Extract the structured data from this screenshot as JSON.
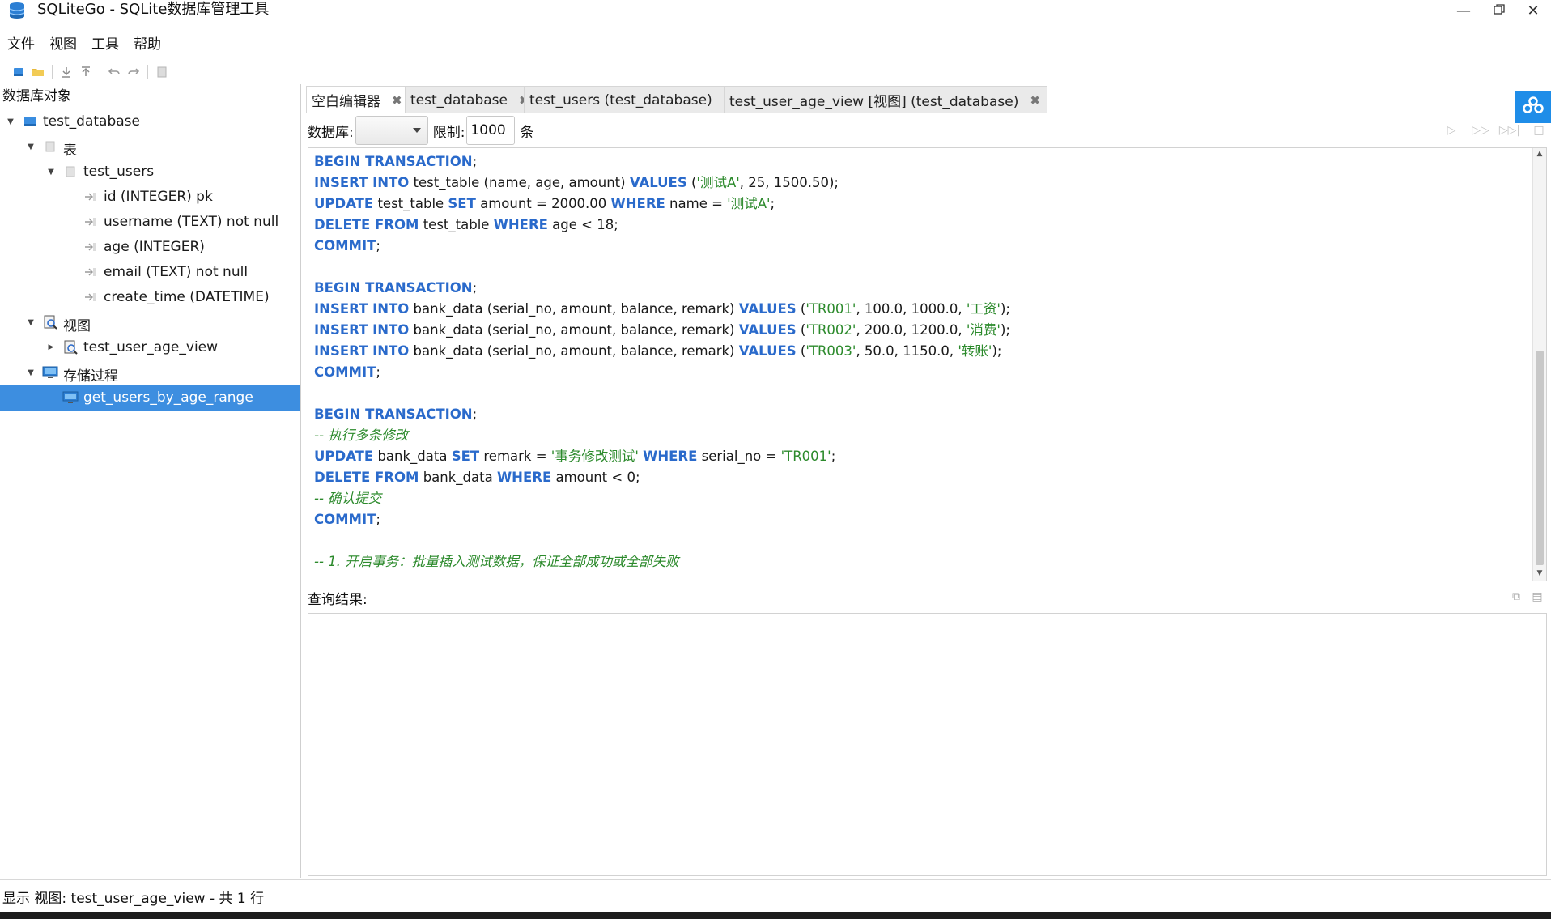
{
  "window": {
    "title": "SQLiteGo - SQLite数据库管理工具",
    "min_icon": "minimize-icon",
    "max_icon": "restore-icon",
    "close_icon": "close-icon"
  },
  "menu": [
    "文件",
    "视图",
    "工具",
    "帮助"
  ],
  "left_panel": {
    "header": "数据库对象",
    "tree": [
      {
        "label": "test_database",
        "icon": "database-icon",
        "expanded": true,
        "level": 0
      },
      {
        "label": "表",
        "icon": "table-folder-icon",
        "expanded": true,
        "level": 1
      },
      {
        "label": "test_users",
        "icon": "table-icon",
        "expanded": true,
        "level": 2
      },
      {
        "label": "id (INTEGER) pk",
        "icon": "column-icon",
        "level": 3
      },
      {
        "label": "username (TEXT) not null",
        "icon": "column-icon",
        "level": 3
      },
      {
        "label": "age (INTEGER)",
        "icon": "column-icon",
        "level": 3
      },
      {
        "label": "email (TEXT) not null",
        "icon": "column-icon",
        "level": 3
      },
      {
        "label": "create_time (DATETIME)",
        "icon": "column-icon",
        "level": 3
      },
      {
        "label": "视图",
        "icon": "view-folder-icon",
        "expanded": true,
        "level": 1
      },
      {
        "label": "test_user_age_view",
        "icon": "view-icon",
        "expanded": false,
        "level": 2
      },
      {
        "label": "存储过程",
        "icon": "procedure-folder-icon",
        "expanded": true,
        "level": 1
      },
      {
        "label": "get_users_by_age_range",
        "icon": "procedure-icon",
        "level": 2,
        "selected": true
      }
    ]
  },
  "tabs": [
    {
      "label": "空白编辑器",
      "active": true
    },
    {
      "label": "test_database",
      "active": false
    },
    {
      "label": "test_users (test_database)",
      "active": false
    },
    {
      "label": "test_user_age_view [视图] (test_database)",
      "active": false
    }
  ],
  "query_bar": {
    "db_label": "数据库:",
    "db_value": "",
    "limit_label": "限制:",
    "limit_value": "1000",
    "limit_unit": "条"
  },
  "editor": {
    "lines": [
      [
        [
          "kw",
          "BEGIN TRANSACTION"
        ],
        [
          "t",
          ";"
        ]
      ],
      [
        [
          "kw",
          "INSERT INTO"
        ],
        [
          "t",
          " test_table (name, age, amount) "
        ],
        [
          "kw",
          "VALUES"
        ],
        [
          "t",
          " ("
        ],
        [
          "str",
          "'测试A'"
        ],
        [
          "t",
          ", 25, 1500.50);"
        ]
      ],
      [
        [
          "kw",
          "UPDATE"
        ],
        [
          "t",
          " test_table "
        ],
        [
          "kw",
          "SET"
        ],
        [
          "t",
          " amount = 2000.00 "
        ],
        [
          "kw",
          "WHERE"
        ],
        [
          "t",
          " name = "
        ],
        [
          "str",
          "'测试A'"
        ],
        [
          "t",
          ";"
        ]
      ],
      [
        [
          "kw",
          "DELETE FROM"
        ],
        [
          "t",
          " test_table "
        ],
        [
          "kw",
          "WHERE"
        ],
        [
          "t",
          " age < 18;"
        ]
      ],
      [
        [
          "kw",
          "COMMIT"
        ],
        [
          "t",
          ";"
        ]
      ],
      [],
      [
        [
          "kw",
          "BEGIN TRANSACTION"
        ],
        [
          "t",
          ";"
        ]
      ],
      [
        [
          "kw",
          "INSERT INTO"
        ],
        [
          "t",
          " bank_data (serial_no, amount, balance, remark) "
        ],
        [
          "kw",
          "VALUES"
        ],
        [
          "t",
          " ("
        ],
        [
          "str",
          "'TR001'"
        ],
        [
          "t",
          ", 100.0, 1000.0, "
        ],
        [
          "str",
          "'工资'"
        ],
        [
          "t",
          ");"
        ]
      ],
      [
        [
          "kw",
          "INSERT INTO"
        ],
        [
          "t",
          " bank_data (serial_no, amount, balance, remark) "
        ],
        [
          "kw",
          "VALUES"
        ],
        [
          "t",
          " ("
        ],
        [
          "str",
          "'TR002'"
        ],
        [
          "t",
          ", 200.0, 1200.0, "
        ],
        [
          "str",
          "'消费'"
        ],
        [
          "t",
          ");"
        ]
      ],
      [
        [
          "kw",
          "INSERT INTO"
        ],
        [
          "t",
          " bank_data (serial_no, amount, balance, remark) "
        ],
        [
          "kw",
          "VALUES"
        ],
        [
          "t",
          " ("
        ],
        [
          "str",
          "'TR003'"
        ],
        [
          "t",
          ", 50.0, 1150.0, "
        ],
        [
          "str",
          "'转账'"
        ],
        [
          "t",
          ");"
        ]
      ],
      [
        [
          "kw",
          "COMMIT"
        ],
        [
          "t",
          ";"
        ]
      ],
      [],
      [
        [
          "kw",
          "BEGIN TRANSACTION"
        ],
        [
          "t",
          ";"
        ]
      ],
      [
        [
          "cmt",
          "-- 执行多条修改"
        ]
      ],
      [
        [
          "kw",
          "UPDATE"
        ],
        [
          "t",
          " bank_data "
        ],
        [
          "kw",
          "SET"
        ],
        [
          "t",
          " remark = "
        ],
        [
          "str",
          "'事务修改测试'"
        ],
        [
          "t",
          " "
        ],
        [
          "kw",
          "WHERE"
        ],
        [
          "t",
          " serial_no = "
        ],
        [
          "str",
          "'TR001'"
        ],
        [
          "t",
          ";"
        ]
      ],
      [
        [
          "kw",
          "DELETE FROM"
        ],
        [
          "t",
          " bank_data "
        ],
        [
          "kw",
          "WHERE"
        ],
        [
          "t",
          " amount < 0;"
        ]
      ],
      [
        [
          "cmt",
          "-- 确认提交"
        ]
      ],
      [
        [
          "kw",
          "COMMIT"
        ],
        [
          "t",
          ";"
        ]
      ],
      [],
      [
        [
          "cmt",
          "-- 1. 开启事务：批量插入测试数据，保证全部成功或全部失败"
        ]
      ]
    ]
  },
  "result": {
    "label": "查询结果:"
  },
  "status": {
    "text": "显示 视图: test_user_age_view - 共 1 行"
  }
}
